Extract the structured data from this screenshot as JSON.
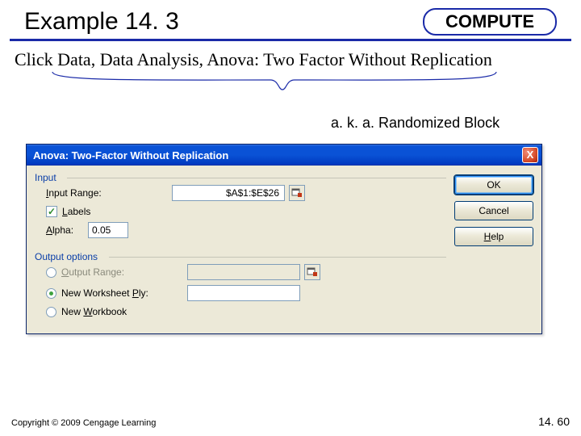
{
  "header": {
    "title": "Example 14. 3",
    "badge": "COMPUTE"
  },
  "instruction": "Click Data, Data Analysis, Anova: Two Factor Without Replication",
  "aka": "a. k. a. Randomized Block",
  "dialog": {
    "title": "Anova: Two-Factor Without Replication",
    "close": "X",
    "input_group": "Input",
    "input_range_label": "Input Range:",
    "input_range_value": "$A$1:$E$26",
    "labels_checked": "✓",
    "labels_text": "Labels",
    "alpha_label": "Alpha:",
    "alpha_value": "0.05",
    "output_group": "Output options",
    "output_range_label": "Output Range:",
    "output_range_value": "",
    "new_ws_label": "New Worksheet Ply:",
    "new_ws_value": "",
    "new_wb_label": "New Workbook",
    "buttons": {
      "ok": "OK",
      "cancel": "Cancel",
      "help": "Help"
    }
  },
  "footer": {
    "copyright": "Copyright © 2009 Cengage Learning",
    "page": "14. 60"
  }
}
